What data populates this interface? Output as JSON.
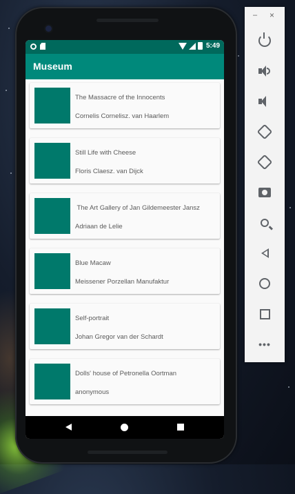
{
  "statusbar": {
    "time": "5:49"
  },
  "appbar": {
    "title": "Museum"
  },
  "artworks": [
    {
      "title": "The Massacre of the Innocents",
      "artist": "Cornelis Cornelisz. van Haarlem"
    },
    {
      "title": "Still Life with Cheese",
      "artist": "Floris Claesz. van Dijck"
    },
    {
      "title": " The Art Gallery of Jan Gildemeester Jansz",
      "artist": "Adriaan de Lelie"
    },
    {
      "title": "Blue Macaw",
      "artist": "Meissener Porzellan Manufaktur"
    },
    {
      "title": "Self-portrait",
      "artist": "Johan Gregor van der Schardt"
    },
    {
      "title": "Dolls' house of Petronella Oortman",
      "artist": "anonymous"
    }
  ],
  "colors": {
    "appbar": "#00897b",
    "statusbar": "#00695c",
    "thumbnail": "#00796b"
  },
  "toolbar": {
    "minimize": "–",
    "close": "×",
    "buttons": [
      "power-icon",
      "volume-up-icon",
      "volume-down-icon",
      "rotate-left-icon",
      "rotate-right-icon",
      "camera-icon",
      "zoom-icon",
      "back-icon",
      "home-icon",
      "overview-icon",
      "more-icon"
    ]
  }
}
